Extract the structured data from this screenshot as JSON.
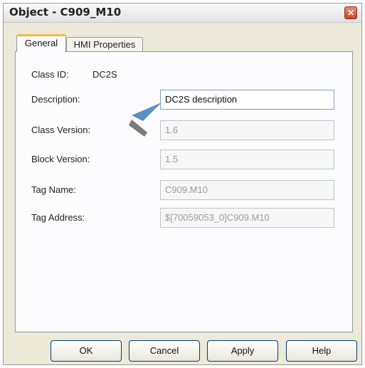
{
  "window": {
    "title": "Object - C909_M10",
    "close_glyph": "✕"
  },
  "tabs": [
    {
      "label": "General",
      "active": true
    },
    {
      "label": "HMI Properties",
      "active": false
    }
  ],
  "general": {
    "class_id_label": "Class ID:",
    "class_id_value": "DC2S",
    "description_label": "Description:",
    "description_value": "DC2S description",
    "class_version_label": "Class Version:",
    "class_version_value": "1.6",
    "block_version_label": "Block Version:",
    "block_version_value": "1.5",
    "tag_name_label": "Tag Name:",
    "tag_name_value": "C909.M10",
    "tag_address_label": "Tag Address:",
    "tag_address_value": "$[70059053_0]C909.M10"
  },
  "buttons": {
    "ok": "OK",
    "cancel": "Cancel",
    "apply": "Apply",
    "help": "Help"
  },
  "colors": {
    "dialog_bg": "#ece9d8",
    "tab_highlight": "#f5b840",
    "button_border": "#003c74",
    "pointer_arrow": "#5b8fc4"
  },
  "icons": {
    "close": "close-icon",
    "pointer": "arrow-pointer-icon"
  }
}
